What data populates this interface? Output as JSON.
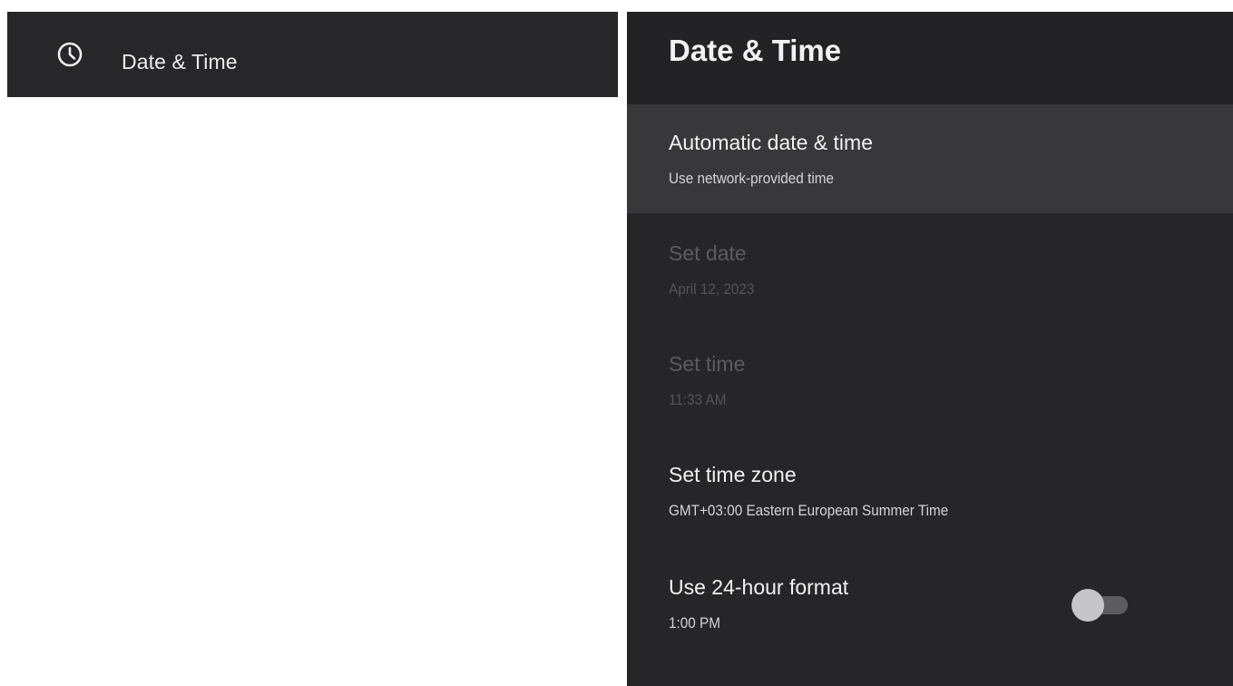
{
  "left_panel": {
    "icon": "clock-icon",
    "title": "Date & Time"
  },
  "right_panel": {
    "title": "Date & Time",
    "items": [
      {
        "title": "Automatic date & time",
        "subtitle": "Use network-provided time",
        "focused": true,
        "enabled": true
      },
      {
        "title": "Set date",
        "subtitle": "April 12, 2023",
        "enabled": false
      },
      {
        "title": "Set time",
        "subtitle": "11:33 AM",
        "enabled": false
      },
      {
        "title": "Set time zone",
        "subtitle": "GMT+03:00 Eastern European Summer Time",
        "enabled": true
      },
      {
        "title": "Use 24-hour format",
        "subtitle": "1:00 PM",
        "enabled": true,
        "toggle": "off"
      }
    ]
  },
  "colors": {
    "panel_background": "#262628",
    "focused_row": "#38383a",
    "left_header": "#272729",
    "text_primary": "#f1f1f1",
    "text_disabled": "#5c5c5e"
  }
}
